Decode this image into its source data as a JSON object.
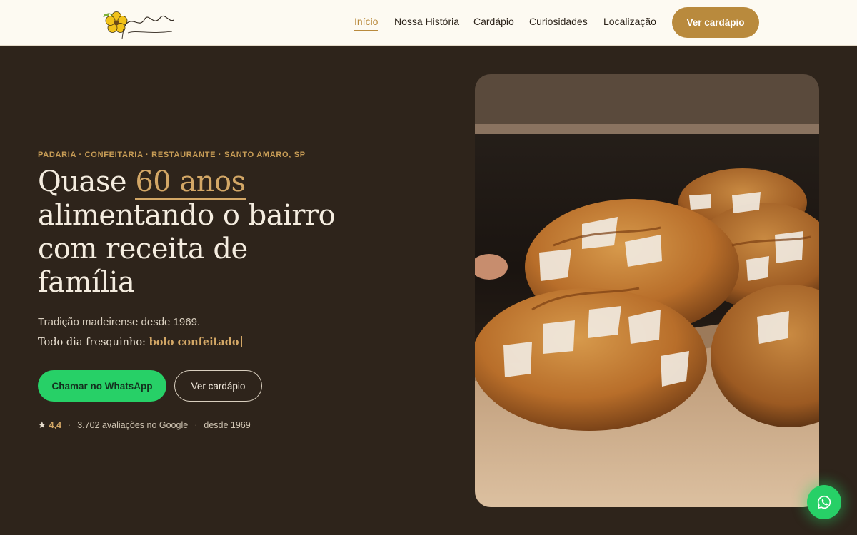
{
  "brand": {
    "logo_name": "Flor da Amarosa",
    "logo_tagline": "Arte em pães e doces"
  },
  "nav": {
    "items": [
      {
        "label": "Início",
        "active": true
      },
      {
        "label": "Nossa História",
        "active": false
      },
      {
        "label": "Cardápio",
        "active": false
      },
      {
        "label": "Curiosidades",
        "active": false
      },
      {
        "label": "Localização",
        "active": false
      }
    ],
    "cta_label": "Ver cardápio"
  },
  "hero": {
    "eyebrow": "PADARIA · CONFEITARIA · RESTAURANTE · SANTO AMARO, SP",
    "headline_before": "Quase ",
    "headline_accent": "60 anos",
    "headline_after": " alimentando o bairro com receita de família",
    "subtitle": "Tradição madeirense desde 1969.",
    "daily_prefix": "Todo dia fresquinho: ",
    "daily_item": "bolo confeitado",
    "whatsapp_button": "Chamar no WhatsApp",
    "menu_button": "Ver cardápio",
    "rating": "4,4",
    "reviews": "3.702 avaliações no Google",
    "since": "desde 1969",
    "image_icon": "bread-loaves-photo"
  },
  "floating": {
    "icon": "whatsapp-icon"
  },
  "colors": {
    "background": "#2e241b",
    "accent_gold": "#b98a3d",
    "whatsapp_green": "#27d067",
    "header_bg": "#fdfaf2"
  }
}
